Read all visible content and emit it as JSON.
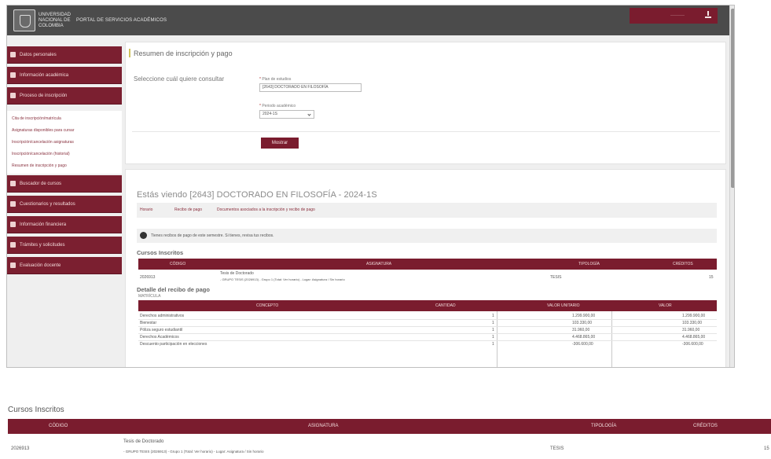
{
  "header": {
    "university_name": "UNIVERSIDAD NACIONAL DE COLOMBIA",
    "portal_title": "PORTAL DE SERVICIOS ACADÉMICOS",
    "user_button_label": "·········"
  },
  "sidebar": {
    "items": [
      {
        "label": "Datos personales"
      },
      {
        "label": "Información académica"
      },
      {
        "label": "Proceso de inscripción"
      },
      {
        "label": "Buscador de cursos"
      },
      {
        "label": "Cuestionarios y resultados"
      },
      {
        "label": "Información financiera"
      },
      {
        "label": "Trámites y solicitudes"
      },
      {
        "label": "Evaluación docente"
      }
    ],
    "subitems": [
      {
        "label": "Cita de inscripción/matrícula"
      },
      {
        "label": "Asignaturas disponibles para cursar"
      },
      {
        "label": "Inscripción/cancelación asignaturas"
      },
      {
        "label": "Inscripción/cancelación (historial)"
      },
      {
        "label": "Resumen de inscripción y pago"
      }
    ]
  },
  "query_panel": {
    "title": "Resumen de inscripción y pago",
    "select_label": "Seleccione cuál quiere consultar",
    "plan_label": "Plan de estudios",
    "plan_value": "[2643] DOCTORADO EN FILOSOFÍA",
    "period_label": "Periodo académico",
    "period_value": "2024-1S",
    "button_label": "Mostrar"
  },
  "result_panel": {
    "title": "Estás viendo [2643] DOCTORADO EN FILOSOFÍA - 2024-1S",
    "links": [
      "Horario",
      "Recibo de pago",
      "Documentos asociados a la inscripción y recibo de pago"
    ],
    "info_text": "Tienes recibos de pago de este semestre. Si tienes, revisa tus recibos.",
    "courses_heading": "Cursos Inscritos",
    "courses_headers": [
      "CÓDIGO",
      "ASIGNATURA",
      "TIPOLOGÍA",
      "CRÉDITOS"
    ],
    "courses_rows": [
      {
        "code": "2026913",
        "name": "Tesis de Doctorado",
        "detail": "- GRUPO TESIS (2026913) - Grupo 1 (Total: Ver horario) - Lugar: Asignatura / Sin horario",
        "type": "TESIS",
        "credits": "15"
      }
    ],
    "payment_heading": "Detalle del recibo de pago",
    "payment_sub": "MATRÍCULA",
    "payment_headers": [
      "CONCEPTO",
      "CANTIDAD",
      "VALOR UNITARIO",
      "VALOR"
    ],
    "payment_rows": [
      {
        "concept": "Derechos administrativos",
        "qty": "1",
        "unit": "1.299.900,00",
        "value": "1.299.900,00"
      },
      {
        "concept": "Bienestar",
        "qty": "1",
        "unit": "103.330,00",
        "value": "103.330,00"
      },
      {
        "concept": "Póliza seguro estudiantil",
        "qty": "1",
        "unit": "31.960,00",
        "value": "31.960,00"
      },
      {
        "concept": "Derechos Académicos",
        "qty": "1",
        "unit": "4.468.865,00",
        "value": "4.468.865,00"
      },
      {
        "concept": "Descuento participación en elecciones",
        "qty": "1",
        "unit": "-306.600,00",
        "value": "-306.600,00"
      }
    ]
  },
  "zoom_section": {
    "heading": "Cursos Inscritos",
    "headers": [
      "CÓDIGO",
      "ASIGNATURA",
      "TIPOLOGÍA",
      "CRÉDITOS"
    ],
    "row": {
      "code": "2026913",
      "name": "Tesis de Doctorado",
      "detail": "- GRUPO TESIS (2026913) - Grupo 1 (Total: Ver horario) - Lugar: Asignatura / Sin horario",
      "type": "TESIS",
      "credits": "15"
    }
  },
  "colors": {
    "brand": "#7a1c2e",
    "topbar": "#4b4b4b",
    "accent": "#cfc35e"
  }
}
